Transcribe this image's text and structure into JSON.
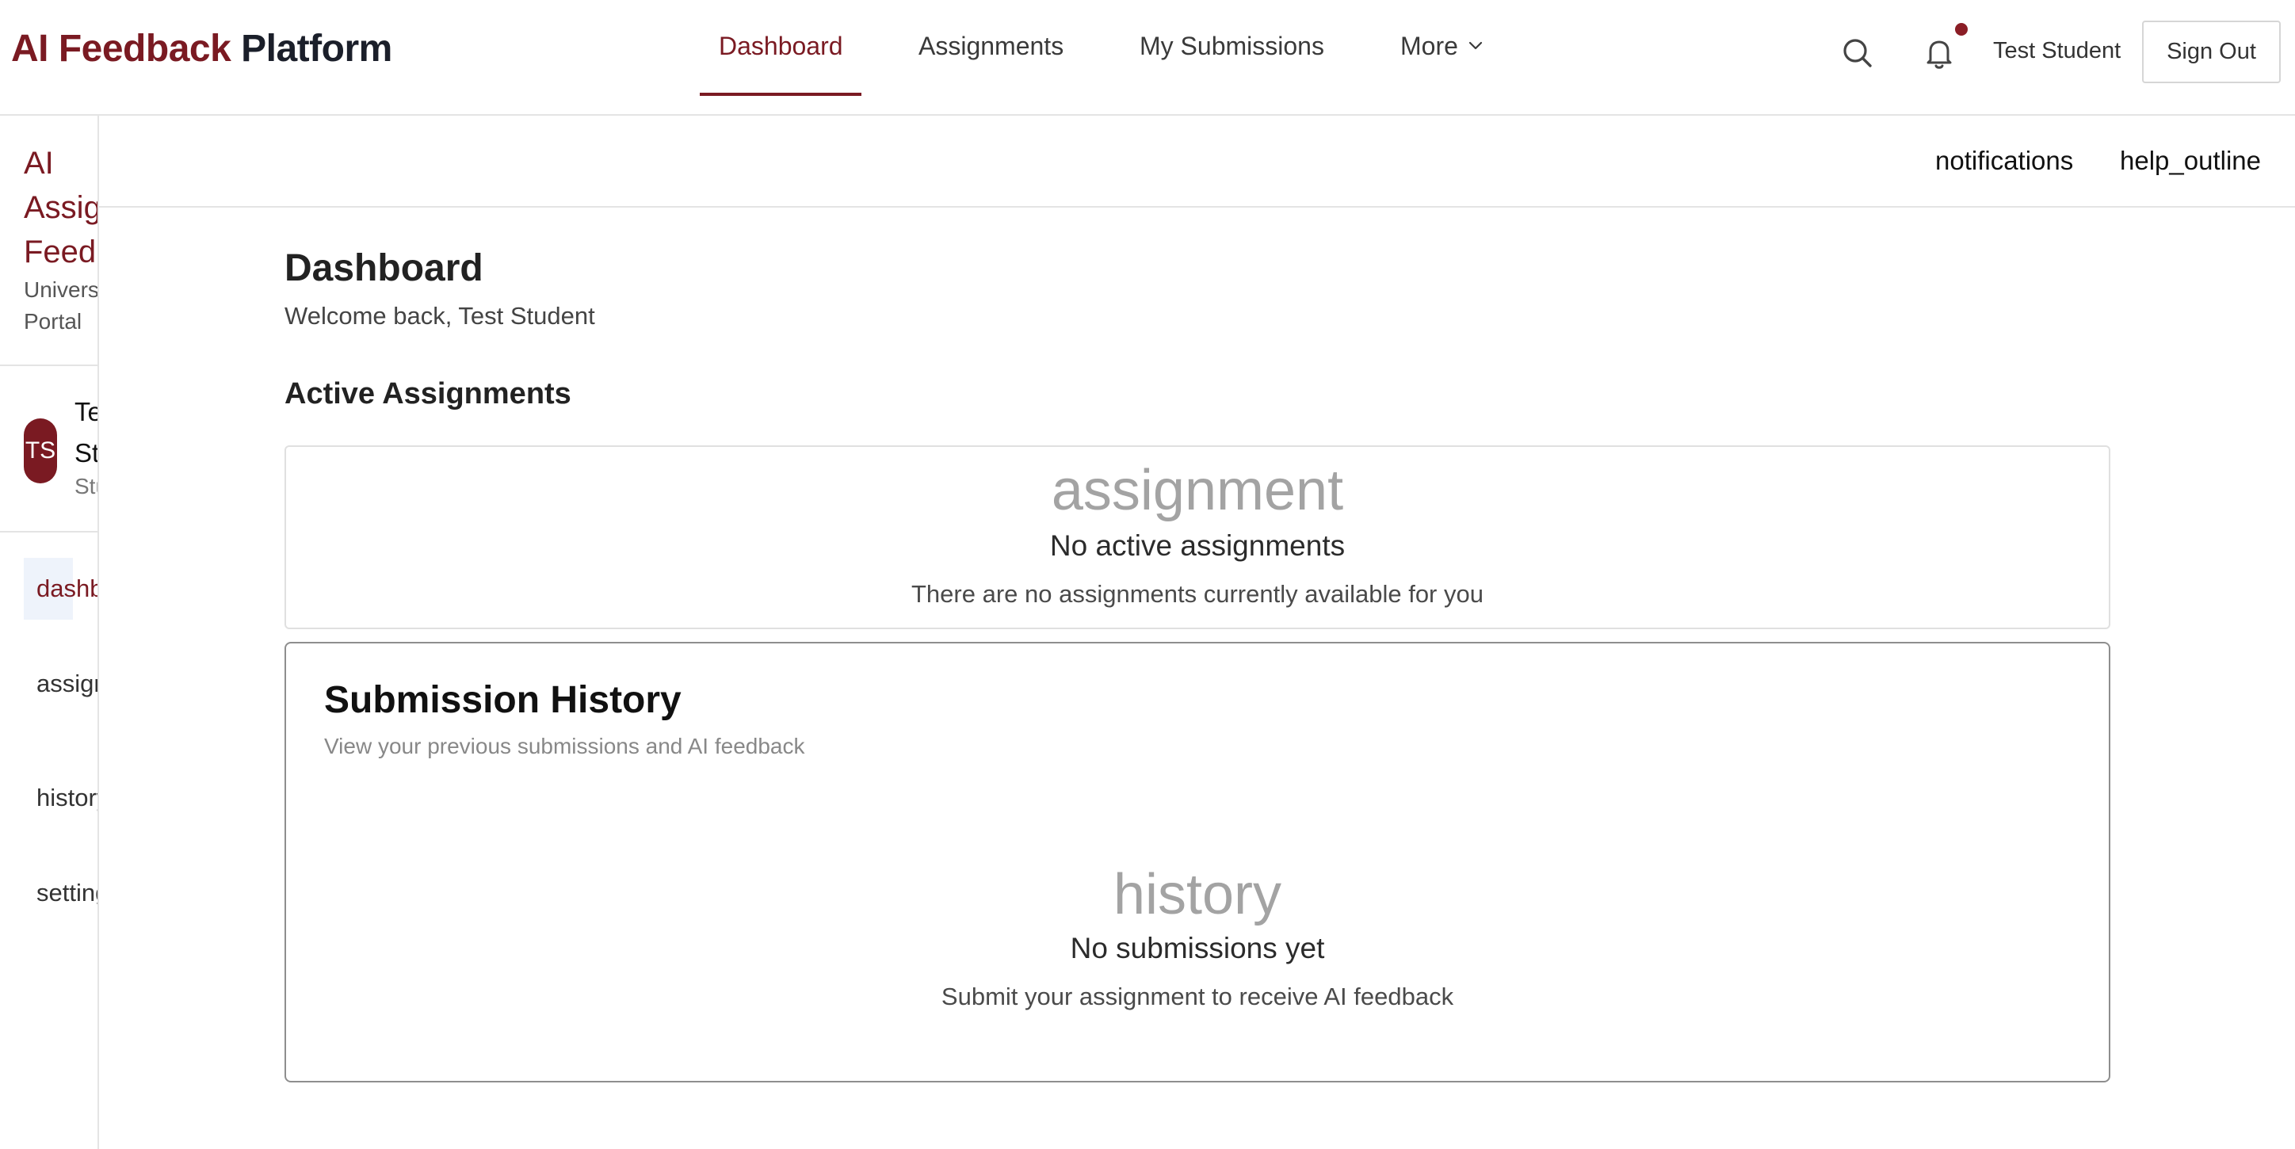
{
  "header": {
    "brand_part1": "AI Feedback",
    "brand_part2": "Platform",
    "nav": [
      {
        "label": "Dashboard",
        "active": true
      },
      {
        "label": "Assignments",
        "active": false
      },
      {
        "label": "My Submissions",
        "active": false
      },
      {
        "label": "More",
        "active": false
      }
    ],
    "user_name": "Test Student",
    "signout_label": "Sign Out",
    "accent_color": "#7a1a22",
    "icons": [
      "search-icon",
      "bell-icon",
      "chevron-down-icon"
    ]
  },
  "sidebar": {
    "title": "AI Assignment Feedback",
    "subtitle": "University Portal",
    "avatar_initials": "TS",
    "user_name": "Test Student",
    "user_role": "Student",
    "items": [
      {
        "label": "dashboard",
        "active": true
      },
      {
        "label": "assignment",
        "active": false
      },
      {
        "label": "history",
        "active": false
      },
      {
        "label": "settings",
        "active": false
      }
    ]
  },
  "subbar": {
    "items": [
      "notifications",
      "help_outline"
    ]
  },
  "main": {
    "title": "Dashboard",
    "welcome": "Welcome back, Test Student",
    "active_section_title": "Active Assignments",
    "active_empty": {
      "icon": "assignment",
      "title": "No active assignments",
      "desc": "There are no assignments currently available for you"
    },
    "history": {
      "title": "Submission History",
      "subtitle": "View your previous submissions and AI feedback",
      "empty_icon": "history",
      "empty_title": "No submissions yet",
      "empty_desc": "Submit your assignment to receive AI feedback"
    }
  }
}
